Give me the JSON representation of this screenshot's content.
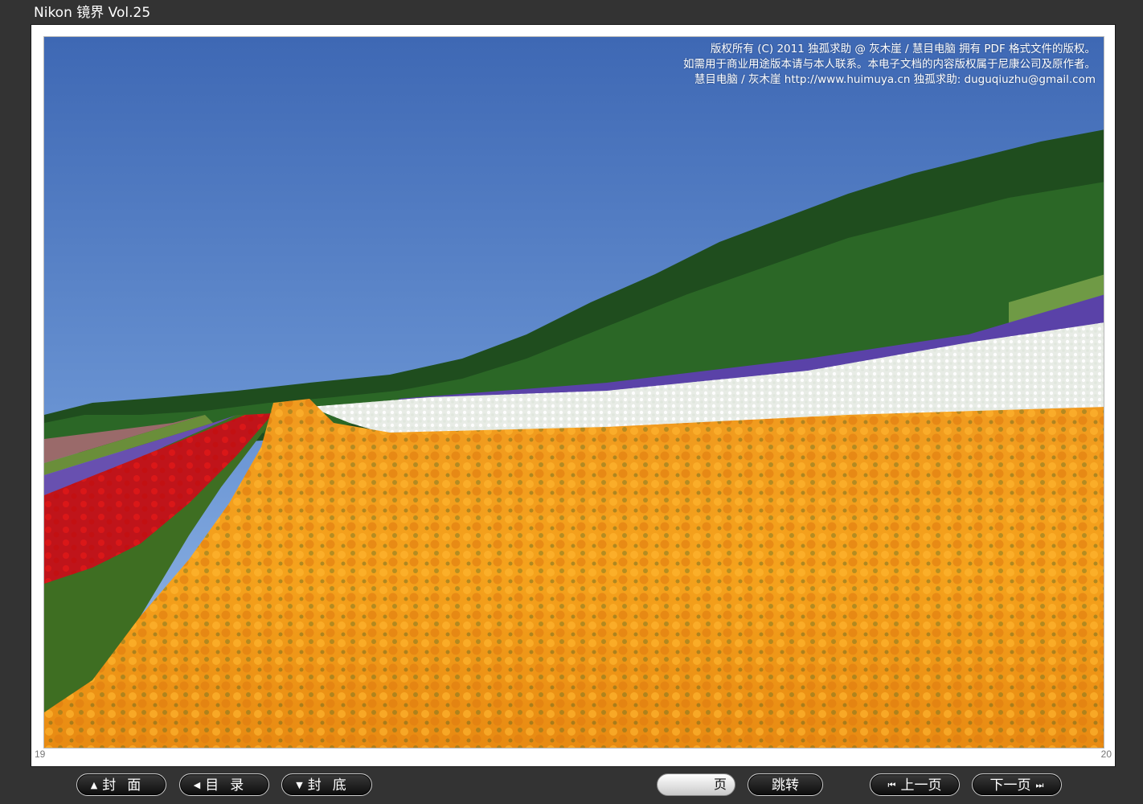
{
  "window": {
    "title": "Nikon 镜界 Vol.25"
  },
  "page": {
    "copyright_lines": [
      "版权所有 (C) 2011 独孤求助 @ 灰木崖 / 慧目电脑 拥有 PDF 格式文件的版权。",
      "如需用于商业用途版本请与本人联系。本电子文档的内容版权属于尼康公司及原作者。",
      "慧目电脑 / 灰木崖 http://www.huimuya.cn  独孤求助: duguqiuzhu@gmail.com"
    ],
    "left_page_number": "19",
    "right_page_number": "20"
  },
  "nav": {
    "cover_label": "封面",
    "toc_label": "目录",
    "back_cover_label": "封底",
    "page_input_value": "",
    "page_unit": "页",
    "jump_label": "跳转",
    "prev_label": "上一页",
    "next_label": "下一页"
  },
  "icons": {
    "cover": "triangle-up-icon",
    "toc": "triangle-left-icon",
    "back_cover": "triangle-down-icon",
    "prev": "skip-back-icon",
    "next": "skip-forward-icon"
  },
  "colors": {
    "background": "#333333",
    "button": "#111111",
    "sky_top": "#3e68b4",
    "poppy_orange": "#f39a1c"
  }
}
